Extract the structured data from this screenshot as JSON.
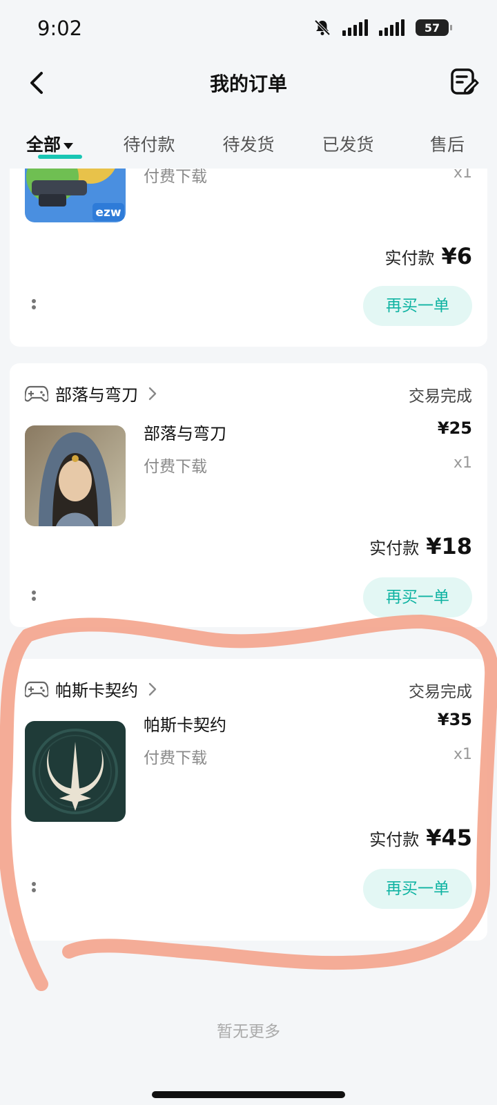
{
  "status_bar": {
    "time": "9:02",
    "battery": "57"
  },
  "header": {
    "title": "我的订单"
  },
  "tabs": [
    {
      "label": "全部",
      "active": true
    },
    {
      "label": "待付款",
      "active": false
    },
    {
      "label": "待发货",
      "active": false
    },
    {
      "label": "已发货",
      "active": false
    },
    {
      "label": "售后",
      "active": false
    }
  ],
  "orders": [
    {
      "product_type": "付费下载",
      "qty": "x1",
      "paid_label": "实付款",
      "paid_amount": "¥6",
      "rebuy_label": "再买一单"
    },
    {
      "shop": "部落与弯刀",
      "status": "交易完成",
      "product_name": "部落与弯刀",
      "product_type": "付费下载",
      "price": "¥25",
      "qty": "x1",
      "paid_label": "实付款",
      "paid_amount": "¥18",
      "rebuy_label": "再买一单"
    },
    {
      "shop": "帕斯卡契约",
      "status": "交易完成",
      "product_name": "帕斯卡契约",
      "product_type": "付费下载",
      "price": "¥35",
      "qty": "x1",
      "paid_label": "实付款",
      "paid_amount": "¥45",
      "rebuy_label": "再买一单"
    }
  ],
  "first_thumb_badge": "ezw",
  "footer": {
    "no_more": "暂无更多"
  },
  "colors": {
    "accent": "#19c6b4",
    "rebuy_bg": "#e3f7f4",
    "rebuy_text": "#0fb3a2",
    "annotation": "#f4a48c"
  },
  "icons": [
    "bell-muted-icon",
    "signal-icon",
    "battery-icon",
    "back-arrow-icon",
    "edit-orders-icon",
    "gamepad-icon",
    "chevron-right-icon",
    "more-dots-icon"
  ]
}
